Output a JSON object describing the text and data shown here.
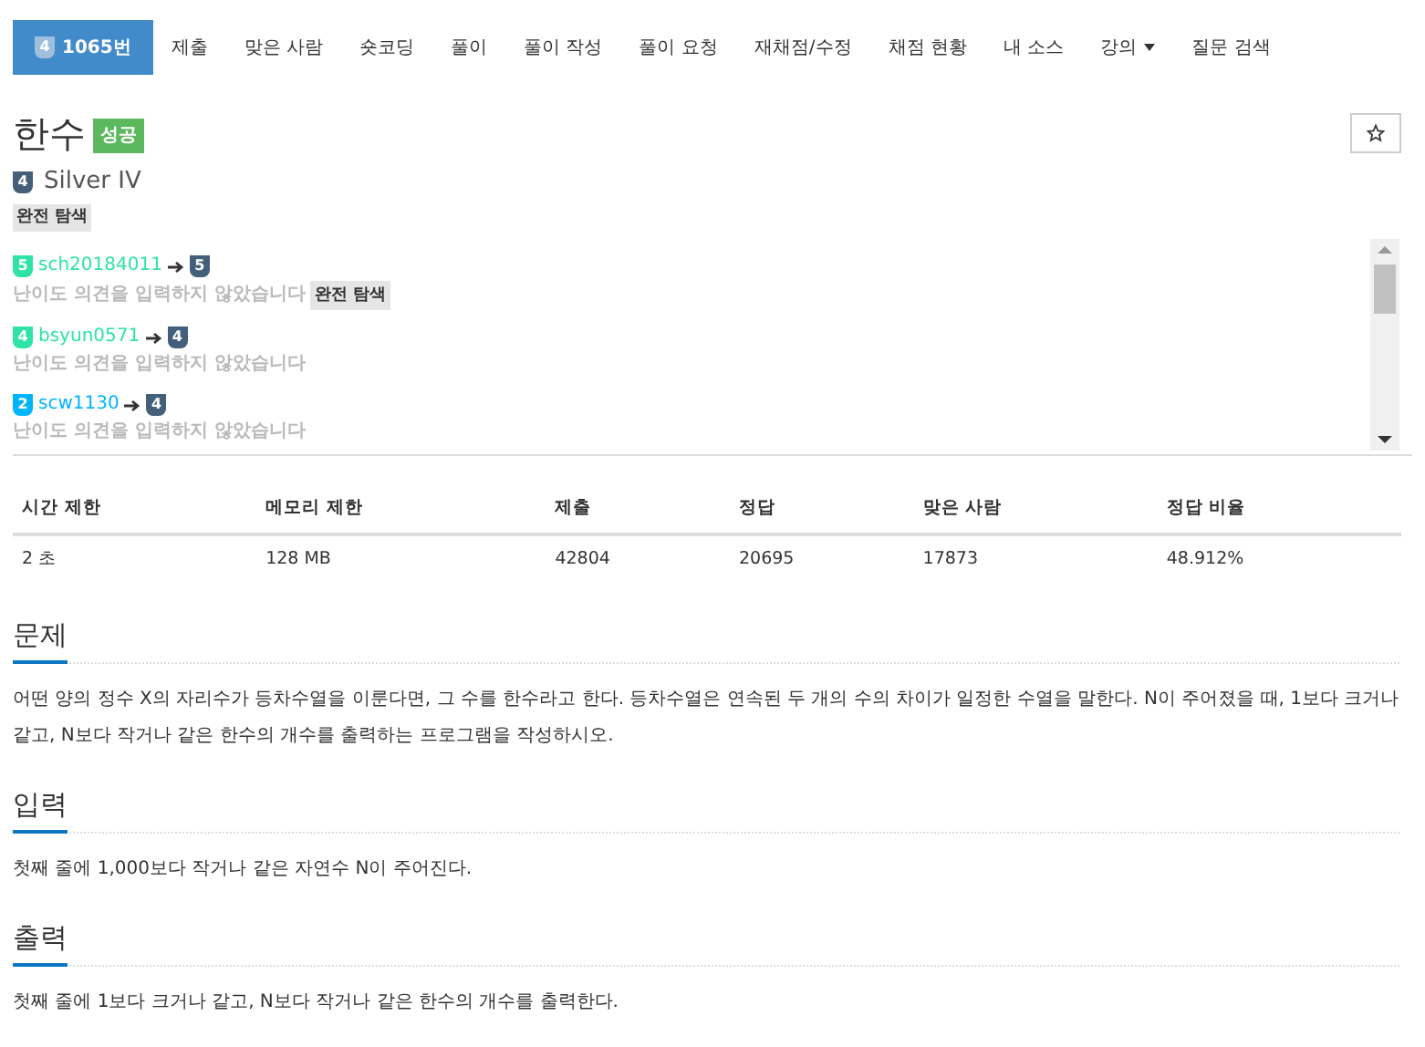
{
  "nav": [
    {
      "label": "1065번",
      "selected": true,
      "tier": "4",
      "dropdown": false
    },
    {
      "label": "제출",
      "selected": false,
      "dropdown": false
    },
    {
      "label": "맞은 사람",
      "selected": false,
      "dropdown": false
    },
    {
      "label": "숏코딩",
      "selected": false,
      "dropdown": false
    },
    {
      "label": "풀이",
      "selected": false,
      "dropdown": false
    },
    {
      "label": "풀이 작성",
      "selected": false,
      "dropdown": false
    },
    {
      "label": "풀이 요청",
      "selected": false,
      "dropdown": false
    },
    {
      "label": "재채점/수정",
      "selected": false,
      "dropdown": false
    },
    {
      "label": "채점 현황",
      "selected": false,
      "dropdown": false
    },
    {
      "label": "내 소스",
      "selected": false,
      "dropdown": false
    },
    {
      "label": "강의",
      "selected": false,
      "dropdown": true
    },
    {
      "label": "질문 검색",
      "selected": false,
      "dropdown": false
    }
  ],
  "problem": {
    "title": "한수",
    "result_badge": "성공",
    "tier_number": "4",
    "tier": "Silver IV",
    "tags": [
      "완전 탐색"
    ]
  },
  "opinions": [
    {
      "user": {
        "name": "sch20184011",
        "color": "#2ee3a5"
      },
      "from_tier": {
        "label": "5",
        "color": "#2ee3a5"
      },
      "to_tier": {
        "label": "5",
        "color": "#435f7a"
      },
      "comment": "난이도 의견을 입력하지 않았습니다",
      "tags": [
        "완전 탐색"
      ]
    },
    {
      "user": {
        "name": "bsyun0571",
        "color": "#2ee3a5"
      },
      "from_tier": {
        "label": "4",
        "color": "#2ee3a5"
      },
      "to_tier": {
        "label": "4",
        "color": "#435f7a"
      },
      "comment": "난이도 의견을 입력하지 않았습니다"
    },
    {
      "user": {
        "name": "scw1130",
        "color": "#00b4fc"
      },
      "from_tier": {
        "label": "2",
        "color": "#00b4fc"
      },
      "to_tier": {
        "label": "4",
        "color": "#435f7a"
      },
      "comment": "난이도 의견을 입력하지 않았습니다"
    }
  ],
  "stats": {
    "columns": [
      "시간 제한",
      "메모리 제한",
      "제출",
      "정답",
      "맞은 사람",
      "정답 비율"
    ],
    "rows": [
      [
        "2 초",
        "128 MB",
        "42804",
        "20695",
        "17873",
        "48.912%"
      ]
    ]
  },
  "sections": [
    {
      "heading": "문제",
      "text": "어떤 양의 정수 X의 자리수가 등차수열을 이룬다면, 그 수를 한수라고 한다. 등차수열은 연속된 두 개의 수의 차이가 일정한 수열을 말한다. N이 주어졌을 때, 1보다 크거나 같고, N보다 작거나 같은 한수의 개수를 출력하는 프로그램을 작성하시오."
    },
    {
      "heading": "입력",
      "text": "첫째 줄에 1,000보다 작거나 같은 자연수 N이 주어진다."
    },
    {
      "heading": "출력",
      "text": "첫째 줄에 1보다 크거나 같고, N보다 작거나 같은 한수의 개수를 출력한다."
    }
  ]
}
